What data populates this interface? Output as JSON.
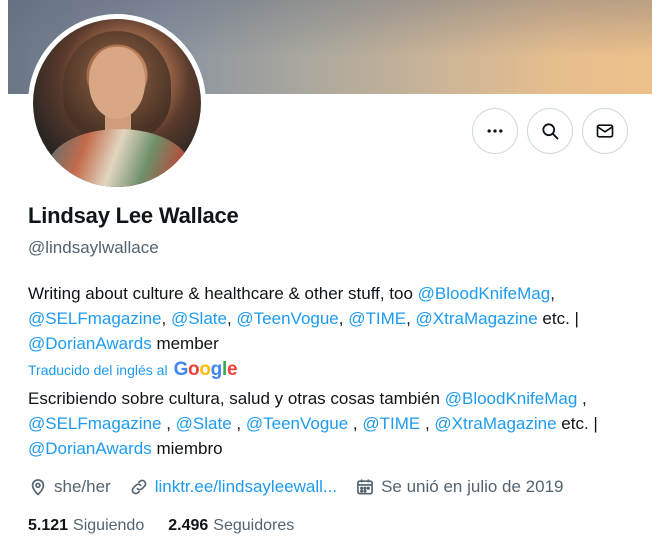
{
  "profile": {
    "name": "Lindsay Lee Wallace",
    "handle": "@lindsaylwallace"
  },
  "actions": {
    "more_icon": "more-horizontal-icon",
    "search_icon": "search-icon",
    "message_icon": "envelope-icon"
  },
  "bio_en": {
    "t1": "Writing about culture & healthcare & other stuff, too ",
    "m1": "@BloodKnifeMag",
    "t2": ", ",
    "m2": "@SELFmagazine",
    "t3": ", ",
    "m3": "@Slate",
    "t4": ", ",
    "m4": "@TeenVogue",
    "t5": ", ",
    "m5": "@TIME",
    "t6": ", ",
    "m6": "@XtraMagazine",
    "t7": " etc. | ",
    "m7": "@DorianAwards",
    "t8": " member"
  },
  "translation": {
    "label": "Traducido del inglés al",
    "provider": "Google"
  },
  "bio_es": {
    "t1": "Escribiendo sobre cultura, salud y otras cosas también ",
    "m1": "@BloodKnifeMag",
    "t2": " , ",
    "m2": "@SELFmagazine",
    "t3": " , ",
    "m3": "@Slate",
    "t4": " , ",
    "m4": "@TeenVogue",
    "t5": " , ",
    "m5": "@TIME",
    "t6": " , ",
    "m6": "@XtraMagazine",
    "t7": " etc. | ",
    "m7": "@DorianAwards",
    "t8": " miembro"
  },
  "meta": {
    "pronouns": "she/her",
    "link": "linktr.ee/lindsayleewall...",
    "joined": "Se unió en julio de 2019"
  },
  "stats": {
    "following_count": "5.121",
    "following_label": "Siguiendo",
    "followers_count": "2.496",
    "followers_label": "Seguidores"
  },
  "colors": {
    "accent": "#1d9bf0",
    "secondary_text": "#536471",
    "primary_text": "#0f1419"
  }
}
